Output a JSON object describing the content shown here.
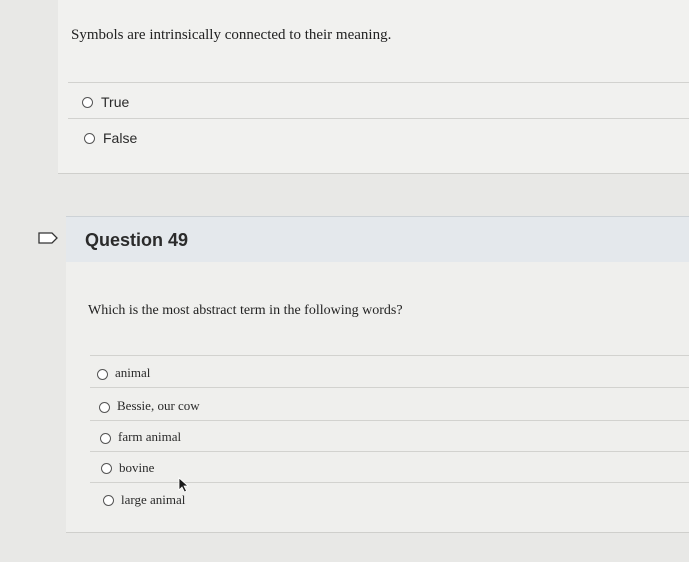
{
  "question48": {
    "text": "Symbols are intrinsically connected to their meaning.",
    "options": [
      "True",
      "False"
    ]
  },
  "question49": {
    "title": "Question 49",
    "text": "Which is the most abstract term in the following words?",
    "options": [
      "animal",
      "Bessie, our cow",
      "farm animal",
      "bovine",
      "large animal"
    ]
  },
  "icons": {
    "flag": "flag-icon",
    "cursor": "mouse-cursor"
  }
}
